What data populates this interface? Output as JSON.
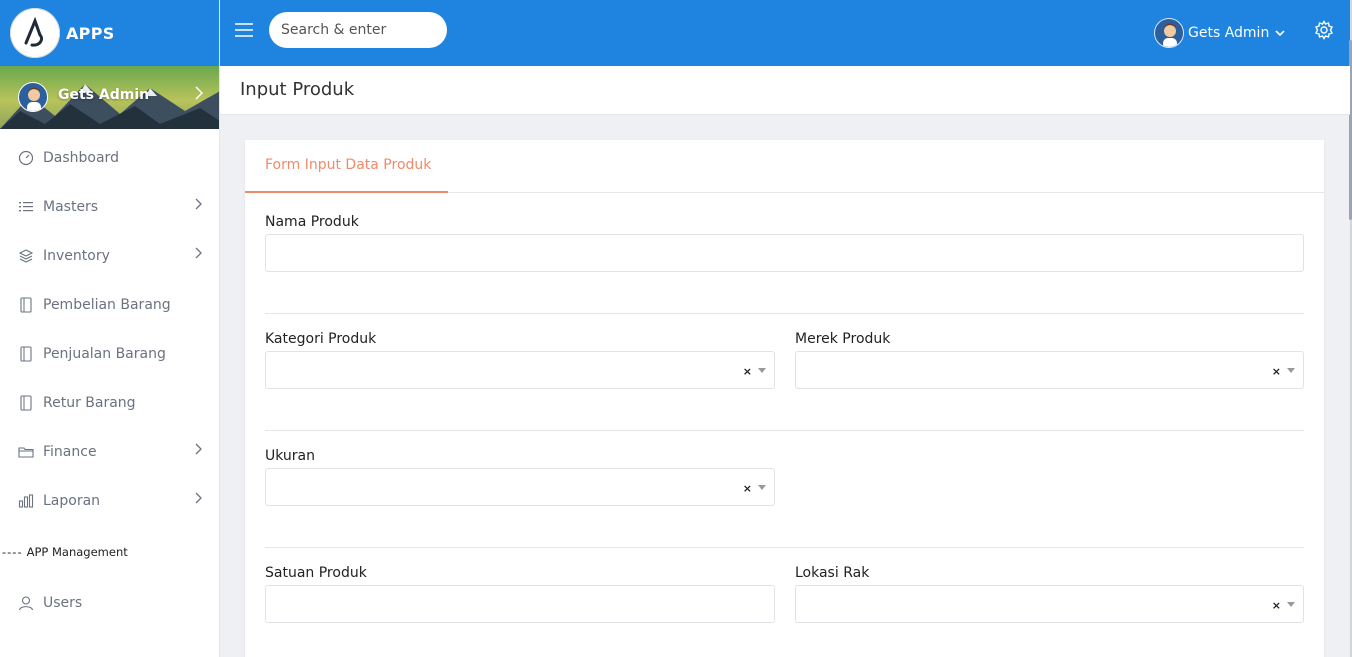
{
  "brand": {
    "name": "APPS"
  },
  "sidebar": {
    "user_name": "Gets Admin",
    "items": [
      {
        "label": "Dashboard",
        "icon": "dashboard-icon",
        "has_children": false
      },
      {
        "label": "Masters",
        "icon": "list-icon",
        "has_children": true
      },
      {
        "label": "Inventory",
        "icon": "layers-icon",
        "has_children": true
      },
      {
        "label": "Pembelian Barang",
        "icon": "notebook-icon",
        "has_children": false
      },
      {
        "label": "Penjualan Barang",
        "icon": "notebook-icon",
        "has_children": false
      },
      {
        "label": "Retur Barang",
        "icon": "notebook-icon",
        "has_children": false
      },
      {
        "label": "Finance",
        "icon": "folder-icon",
        "has_children": true
      },
      {
        "label": "Laporan",
        "icon": "bar-chart-icon",
        "has_children": true
      }
    ],
    "section_dash": "----",
    "section_title": "APP Management",
    "mgmt_items": [
      {
        "label": "Users",
        "icon": "users-icon"
      }
    ]
  },
  "topbar": {
    "search_placeholder": "Search & enter",
    "user_name": "Gets Admin"
  },
  "page": {
    "title": "Input Produk"
  },
  "form": {
    "tab_label": "Form Input Data Produk",
    "fields": {
      "nama_produk": {
        "label": "Nama Produk",
        "value": ""
      },
      "kategori_produk": {
        "label": "Kategori Produk",
        "value": ""
      },
      "merek_produk": {
        "label": "Merek Produk",
        "value": ""
      },
      "ukuran": {
        "label": "Ukuran",
        "value": ""
      },
      "satuan_produk": {
        "label": "Satuan Produk",
        "value": ""
      },
      "lokasi_rak": {
        "label": "Lokasi Rak",
        "value": ""
      }
    },
    "clear_glyph": "×"
  },
  "colors": {
    "primary": "#1e84e0",
    "accent": "#f08a6a",
    "background": "#eef0f4"
  }
}
